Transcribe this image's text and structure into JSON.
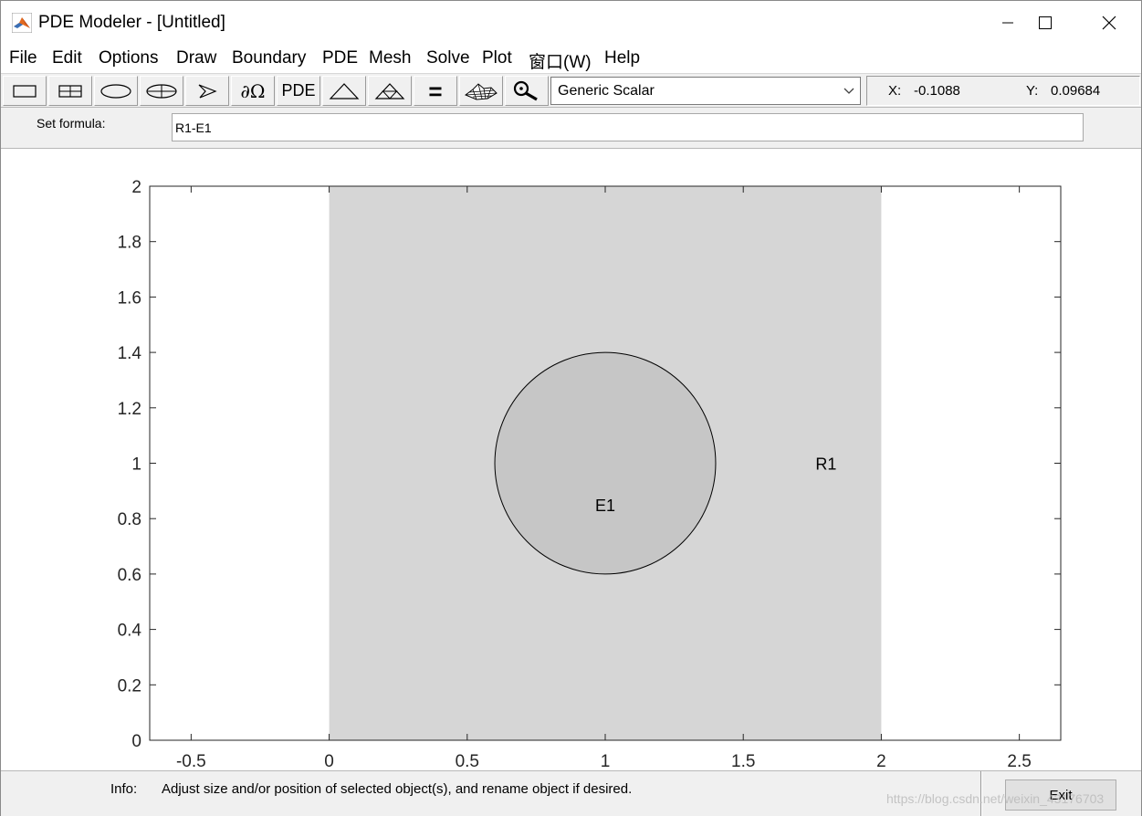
{
  "window": {
    "title": "PDE Modeler - [Untitled]"
  },
  "menu": [
    "File",
    "Edit",
    "Options",
    "Draw",
    "Boundary",
    "PDE",
    "Mesh",
    "Solve",
    "Plot",
    "窗口(W)",
    "Help"
  ],
  "toolbar": {
    "buttons": [
      {
        "name": "rectangle-icon"
      },
      {
        "name": "rectangle-centered-icon"
      },
      {
        "name": "ellipse-icon"
      },
      {
        "name": "ellipse-centered-icon"
      },
      {
        "name": "polygon-icon"
      },
      {
        "name": "boundary-mode-icon",
        "label": "∂Ω"
      },
      {
        "name": "pde-specification-button",
        "label": "PDE"
      },
      {
        "name": "init-mesh-icon"
      },
      {
        "name": "refine-mesh-icon"
      },
      {
        "name": "solve-icon",
        "label": "="
      },
      {
        "name": "plot-icon"
      },
      {
        "name": "zoom-icon"
      }
    ],
    "app_mode": "Generic Scalar",
    "coords": {
      "x_label": "X:",
      "x_value": "-0.1088",
      "y_label": "Y:",
      "y_value": "0.09684"
    }
  },
  "formula": {
    "label": "Set formula:",
    "value": "R1-E1"
  },
  "chart_data": {
    "type": "geometry",
    "xlim": [
      -0.65,
      2.65
    ],
    "ylim": [
      0,
      2
    ],
    "x_ticks": [
      -0.5,
      0,
      0.5,
      1,
      1.5,
      2,
      2.5
    ],
    "x_tick_labels": [
      "-0.5",
      "0",
      "0.5",
      "1",
      "1.5",
      "2",
      "2.5"
    ],
    "y_ticks": [
      0,
      0.2,
      0.4,
      0.6,
      0.8,
      1,
      1.2,
      1.4,
      1.6,
      1.8,
      2
    ],
    "y_tick_labels": [
      "0",
      "0.2",
      "0.4",
      "0.6",
      "0.8",
      "1",
      "1.2",
      "1.4",
      "1.6",
      "1.8",
      "2"
    ],
    "shapes": [
      {
        "type": "rectangle",
        "label": "R1",
        "x": [
          0,
          2
        ],
        "y": [
          0,
          2
        ],
        "label_pos": [
          1.8,
          1
        ],
        "fill": "#d6d6d6"
      },
      {
        "type": "ellipse",
        "label": "E1",
        "center": [
          1,
          1
        ],
        "radius": 0.4,
        "label_pos": [
          1,
          0.85
        ],
        "fill": "#c6c6c6",
        "stroke": "#000000"
      }
    ]
  },
  "info": {
    "label": "Info:",
    "text": "Adjust size and/or position of selected object(s), and rename object if desired.",
    "exit_label": "Exit"
  },
  "watermark": "https://blog.csdn.net/weixin_43176703"
}
